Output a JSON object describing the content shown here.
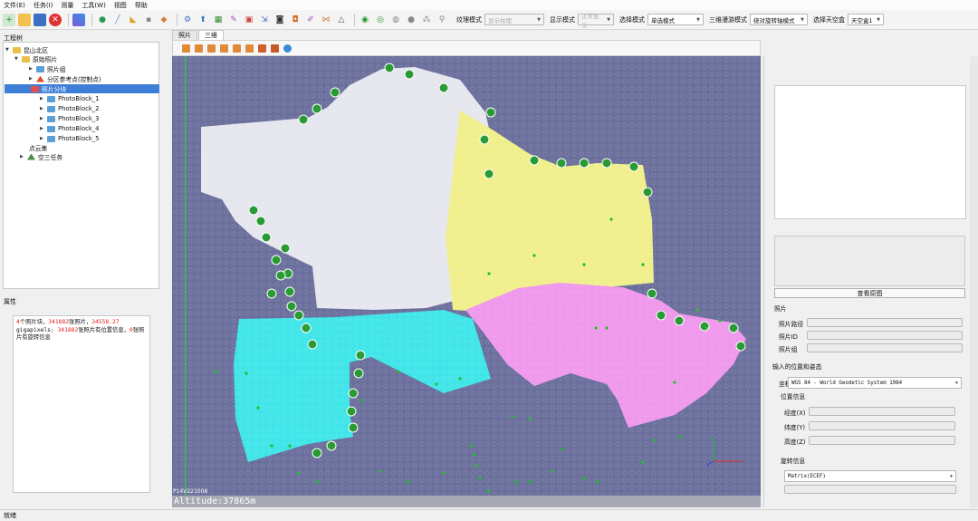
{
  "menu": {
    "file": "文件(E)",
    "task": "任务(I)",
    "measure": "测量",
    "tools": "工具(W)",
    "view": "视图",
    "help": "帮助"
  },
  "toolbar": {
    "texture_label": "纹理模式",
    "texture_value": "显示纹理",
    "display_label": "显示模式",
    "display_value": "正常显示",
    "select_label": "选择模式",
    "select_value": "单选模式",
    "browse_label": "三维漫游模式",
    "browse_value": "绕对旋转轴模式",
    "sky_label": "选择天空盒",
    "sky_value": "天空盒1"
  },
  "tree": {
    "title": "工程树",
    "project": "昆山北区",
    "photos_root": "原始照片",
    "photo_group": "照片组",
    "control": "分区参考点(控制点)",
    "blocks": "照片分块",
    "block_items": [
      "PhotoBlock_1",
      "PhotoBlock_2",
      "PhotoBlock_3",
      "PhotoBlock_4",
      "PhotoBlock_5"
    ],
    "pointcloud": "点云集",
    "aerial": "空三任务"
  },
  "properties": {
    "title": "属性",
    "count_blocks": "4",
    "t1": "个照片块，",
    "count_photos": "341882",
    "t2": "张照片，",
    "gpix": "34558.27",
    "t3": "gigapixels; ",
    "count_pos": "341882",
    "t4": "张照片有位置信息，",
    "count_rot": "0",
    "t5": "张照片有旋转信息"
  },
  "tabs": {
    "photo": "照片",
    "three_d": "三维"
  },
  "viewport": {
    "photo_label": "P14V221008",
    "altitude": "Altitude:37865m"
  },
  "right": {
    "view_image_button": "查看原图",
    "photo_section": "照片",
    "photo_path": "照片路径",
    "photo_id": "照片ID",
    "photo_group": "照片组",
    "pose_section": "输入的位置和姿态",
    "crs_label": "坐标系",
    "crs_value": "WGS 84 - World Geodetic System 1984",
    "position_section": "位置信息",
    "lon": "经度(X)",
    "lat": "纬度(Y)",
    "height": "高度(Z)",
    "rotation_section": "旋转信息",
    "rotation_value": "Matrix(ECEF)"
  },
  "status": "就绪",
  "colors": {
    "accent": "#3d7fd6",
    "viewport_bg": "#6b6f9c",
    "block_white": "#e6e7ee",
    "block_yellow": "#f0ef8c",
    "block_cyan": "#3fe5e8",
    "block_magenta": "#ef98ec",
    "marker_green": "#1fbf2a"
  }
}
